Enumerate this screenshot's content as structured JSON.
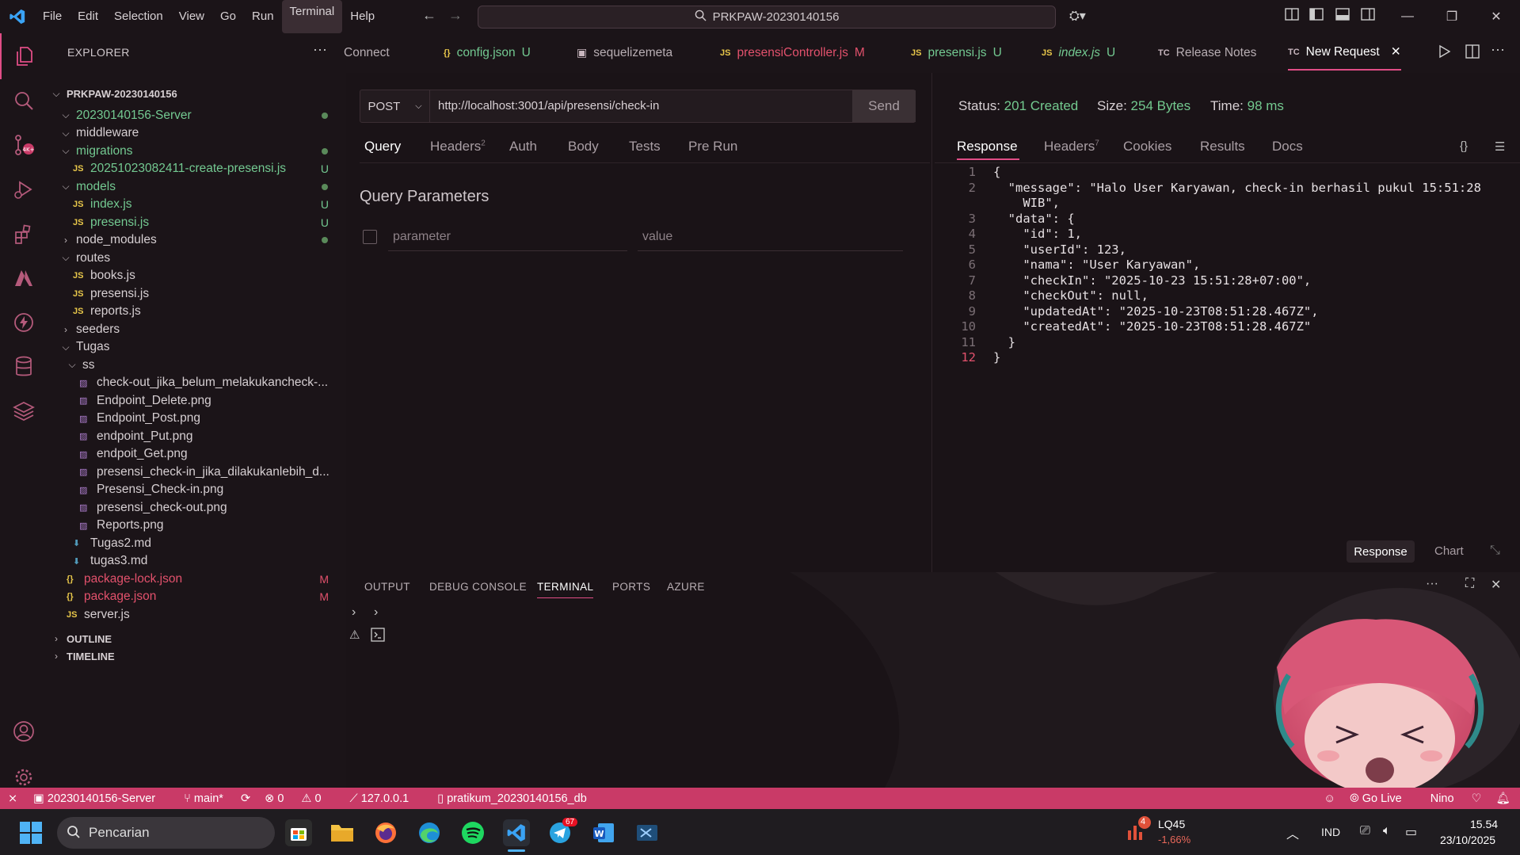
{
  "menu": [
    "File",
    "Edit",
    "Selection",
    "View",
    "Go",
    "Run",
    "Terminal",
    "Help"
  ],
  "search_title": "PRKPAW-20230140156",
  "explorer": {
    "header": "EXPLORER",
    "root": "PRKPAW-20230140156",
    "rows": [
      {
        "label": "20230140156-Server",
        "type": "folder-open",
        "color": "#73c991",
        "badge": "dot"
      },
      {
        "label": "middleware",
        "type": "folder-open",
        "color": "#d6cfd2",
        "badge": ""
      },
      {
        "label": "migrations",
        "type": "folder-open",
        "color": "#73c991",
        "badge": "dot"
      },
      {
        "label": "20251023082411-create-presensi.js",
        "type": "js",
        "color": "#73c991",
        "badge": "U"
      },
      {
        "label": "models",
        "type": "folder-open",
        "color": "#73c991",
        "badge": "dot"
      },
      {
        "label": "index.js",
        "type": "js",
        "color": "#73c991",
        "badge": "U"
      },
      {
        "label": "presensi.js",
        "type": "js",
        "color": "#73c991",
        "badge": "U"
      },
      {
        "label": "node_modules",
        "type": "folder-closed",
        "color": "#d6cfd2",
        "badge": "dot"
      },
      {
        "label": "routes",
        "type": "folder-open",
        "color": "#d6cfd2",
        "badge": ""
      },
      {
        "label": "books.js",
        "type": "js",
        "color": "#d6cfd2",
        "badge": ""
      },
      {
        "label": "presensi.js",
        "type": "js",
        "color": "#d6cfd2",
        "badge": ""
      },
      {
        "label": "reports.js",
        "type": "js",
        "color": "#d6cfd2",
        "badge": ""
      },
      {
        "label": "seeders",
        "type": "folder-closed",
        "color": "#d6cfd2",
        "badge": ""
      },
      {
        "label": "Tugas",
        "type": "folder-open",
        "color": "#d6cfd2",
        "badge": ""
      },
      {
        "label": "ss",
        "type": "folder-open",
        "color": "#d6cfd2",
        "badge": ""
      },
      {
        "label": "check-out_jika_belum_melakukancheck-...",
        "type": "img",
        "color": "#d6cfd2",
        "badge": ""
      },
      {
        "label": "Endpoint_Delete.png",
        "type": "img",
        "color": "#d6cfd2",
        "badge": ""
      },
      {
        "label": "Endpoint_Post.png",
        "type": "img",
        "color": "#d6cfd2",
        "badge": ""
      },
      {
        "label": "endpoint_Put.png",
        "type": "img",
        "color": "#d6cfd2",
        "badge": ""
      },
      {
        "label": "endpoit_Get.png",
        "type": "img",
        "color": "#d6cfd2",
        "badge": ""
      },
      {
        "label": "presensi_check-in_jika_dilakukanlebih_d...",
        "type": "img",
        "color": "#d6cfd2",
        "badge": ""
      },
      {
        "label": "Presensi_Check-in.png",
        "type": "img",
        "color": "#d6cfd2",
        "badge": ""
      },
      {
        "label": "presensi_check-out.png",
        "type": "img",
        "color": "#d6cfd2",
        "badge": ""
      },
      {
        "label": "Reports.png",
        "type": "img",
        "color": "#d6cfd2",
        "badge": ""
      },
      {
        "label": "Tugas2.md",
        "type": "md",
        "color": "#d6cfd2",
        "badge": ""
      },
      {
        "label": "tugas3.md",
        "type": "md",
        "color": "#d6cfd2",
        "badge": ""
      },
      {
        "label": "package-lock.json",
        "type": "json",
        "color": "#e2516c",
        "badge": "M"
      },
      {
        "label": "package.json",
        "type": "json",
        "color": "#e2516c",
        "badge": "M"
      },
      {
        "label": "server.js",
        "type": "js",
        "color": "#d6cfd2",
        "badge": ""
      }
    ],
    "outline": "OUTLINE",
    "timeline": "TIMELINE"
  },
  "tabs": [
    {
      "label": "Connect",
      "icon": "",
      "badge": ""
    },
    {
      "label": "config.json",
      "icon": "{}",
      "badge": "U"
    },
    {
      "label": "sequelizemeta",
      "icon": "table",
      "badge": ""
    },
    {
      "label": "presensiController.js",
      "icon": "JS",
      "badge": "M"
    },
    {
      "label": "presensi.js",
      "icon": "JS",
      "badge": "U"
    },
    {
      "label": "index.js",
      "icon": "JS",
      "badge": "U"
    },
    {
      "label": "Release Notes",
      "icon": "TC",
      "badge": ""
    },
    {
      "label": "New Request",
      "icon": "TC",
      "badge": ""
    }
  ],
  "request": {
    "method": "POST",
    "url": "http://localhost:3001/api/presensi/check-in",
    "send": "Send",
    "tabs": [
      "Query",
      "Headers",
      "Auth",
      "Body",
      "Tests",
      "Pre Run"
    ],
    "headers_count": "2",
    "query_title": "Query Parameters",
    "param_placeholder": "parameter",
    "value_placeholder": "value"
  },
  "response": {
    "status_label": "Status:",
    "status_value": "201 Created",
    "size_label": "Size:",
    "size_value": "254 Bytes",
    "time_label": "Time:",
    "time_value": "98 ms",
    "tabs": [
      "Response",
      "Headers",
      "Cookies",
      "Results",
      "Docs"
    ],
    "headers_count": "7",
    "view_response": "Response",
    "view_chart": "Chart",
    "lines": [
      {
        "n": "1",
        "text": "{"
      },
      {
        "n": "2",
        "text": "  \"message\": \"Halo User Karyawan, check-in berhasil pukul 15:51:28"
      },
      {
        "n": "",
        "text": "    WIB\","
      },
      {
        "n": "3",
        "text": "  \"data\": {"
      },
      {
        "n": "4",
        "text": "    \"id\": 1,"
      },
      {
        "n": "5",
        "text": "    \"userId\": 123,"
      },
      {
        "n": "6",
        "text": "    \"nama\": \"User Karyawan\","
      },
      {
        "n": "7",
        "text": "    \"checkIn\": \"2025-10-23 15:51:28+07:00\","
      },
      {
        "n": "8",
        "text": "    \"checkOut\": null,"
      },
      {
        "n": "9",
        "text": "    \"updatedAt\": \"2025-10-23T08:51:28.467Z\","
      },
      {
        "n": "10",
        "text": "    \"createdAt\": \"2025-10-23T08:51:28.467Z\""
      },
      {
        "n": "11",
        "text": "  }"
      },
      {
        "n": "12",
        "text": "}"
      }
    ]
  },
  "panel": {
    "tabs": [
      "OUTPUT",
      "DEBUG CONSOLE",
      "TERMINAL",
      "PORTS",
      "AZURE"
    ]
  },
  "statusbar": {
    "remote": "20230140156-Server",
    "branch": "main*",
    "problems": "0",
    "warnings": "0",
    "host": "127.0.0.1",
    "db": "pratikum_20230140156_db",
    "golive": "Go Live",
    "user": "Nino"
  },
  "taskbar": {
    "search": "Pencarian",
    "stock_name": "LQ45",
    "stock_change": "-1,66%",
    "stock_badge": "4",
    "lang": "IND",
    "time": "15.54",
    "date": "23/10/2025",
    "telegram_badge": "67"
  },
  "colors": {
    "accent": "#e04d86",
    "status_bar": "#c93a67",
    "success": "#73c98f"
  }
}
